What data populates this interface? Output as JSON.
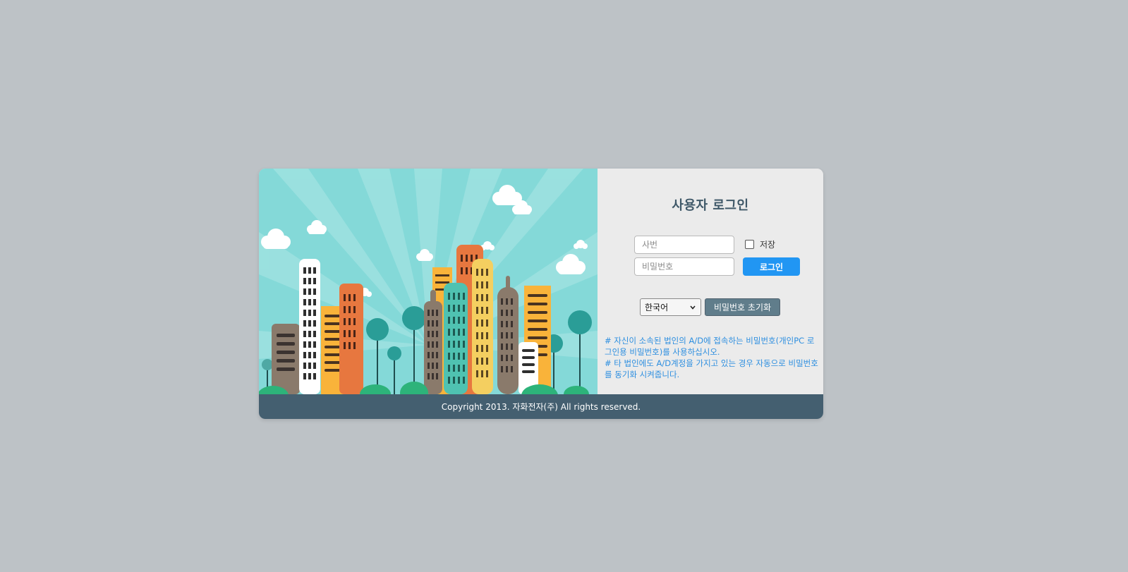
{
  "login": {
    "title": "사용자 로그인",
    "employee_id_placeholder": "사번",
    "password_placeholder": "비밀번호",
    "save_label": "저장",
    "login_button": "로그인",
    "language_selected": "한국어",
    "reset_password_button": "비밀번호 초기화",
    "notices": [
      "# 자신이 소속된 법인의 A/D에 접속하는 비밀번호(개인PC 로그인용 비밀번호)를 사용하십시오.",
      "# 타 법인에도 A/D계정을 가지고 있는 경우 자동으로 비밀번호를 동기화 시켜줍니다."
    ]
  },
  "footer": {
    "copyright": "Copyright 2013. 자화전자(주) All rights reserved."
  },
  "colors": {
    "background": "#bdc2c6",
    "panel": "#ebebeb",
    "title": "#3f5868",
    "login_button": "#2196f3",
    "reset_button": "#607d8b",
    "notice_text": "#2e8fe0",
    "footer": "#445f70",
    "sky": "#84d9d8"
  },
  "illustration": {
    "subject": "city-skyline"
  }
}
